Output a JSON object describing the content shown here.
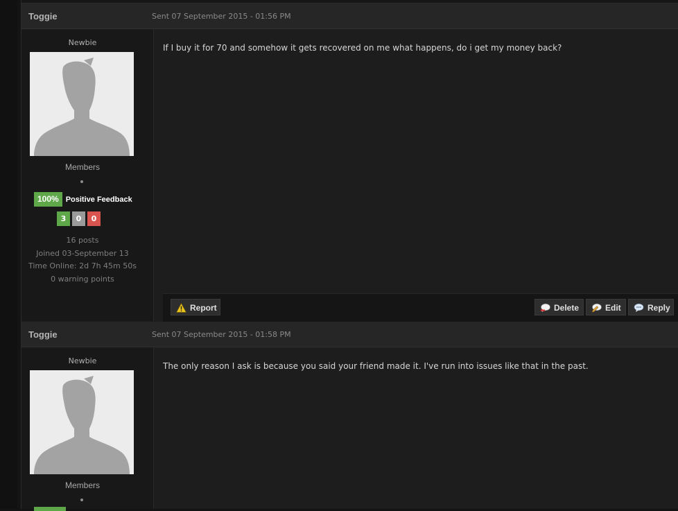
{
  "posts": [
    {
      "author": "Toggie",
      "date": "Sent 07 September 2015 - 01:56 PM",
      "rank": "Newbie",
      "group": "Members",
      "feedback_percent": "100%",
      "feedback_label": "Positive Feedback",
      "counts": {
        "positive": "3",
        "neutral": "0",
        "negative": "0"
      },
      "stats": {
        "posts": "16 posts",
        "joined": "Joined 03-September 13",
        "time_online": "Time Online: 2d 7h 45m 50s",
        "warnings": "0 warning points"
      },
      "content": "If I buy it for 70 and somehow it gets recovered on me what happens, do i get my money back?",
      "actions": {
        "report": "Report",
        "delete": "Delete",
        "edit": "Edit",
        "reply": "Reply"
      }
    },
    {
      "author": "Toggie",
      "date": "Sent 07 September 2015 - 01:58 PM",
      "rank": "Newbie",
      "group": "Members",
      "content": "The only reason I ask is because you said your friend made it. I've run into issues like that in the past."
    }
  ],
  "icons": {
    "report": "warning-icon",
    "delete": "delete-bubble-icon",
    "edit": "edit-bubble-icon",
    "reply": "reply-bubble-icon"
  },
  "colors": {
    "positive": "#5ea84a",
    "neutral": "#9a9a9a",
    "negative": "#d9534f"
  }
}
